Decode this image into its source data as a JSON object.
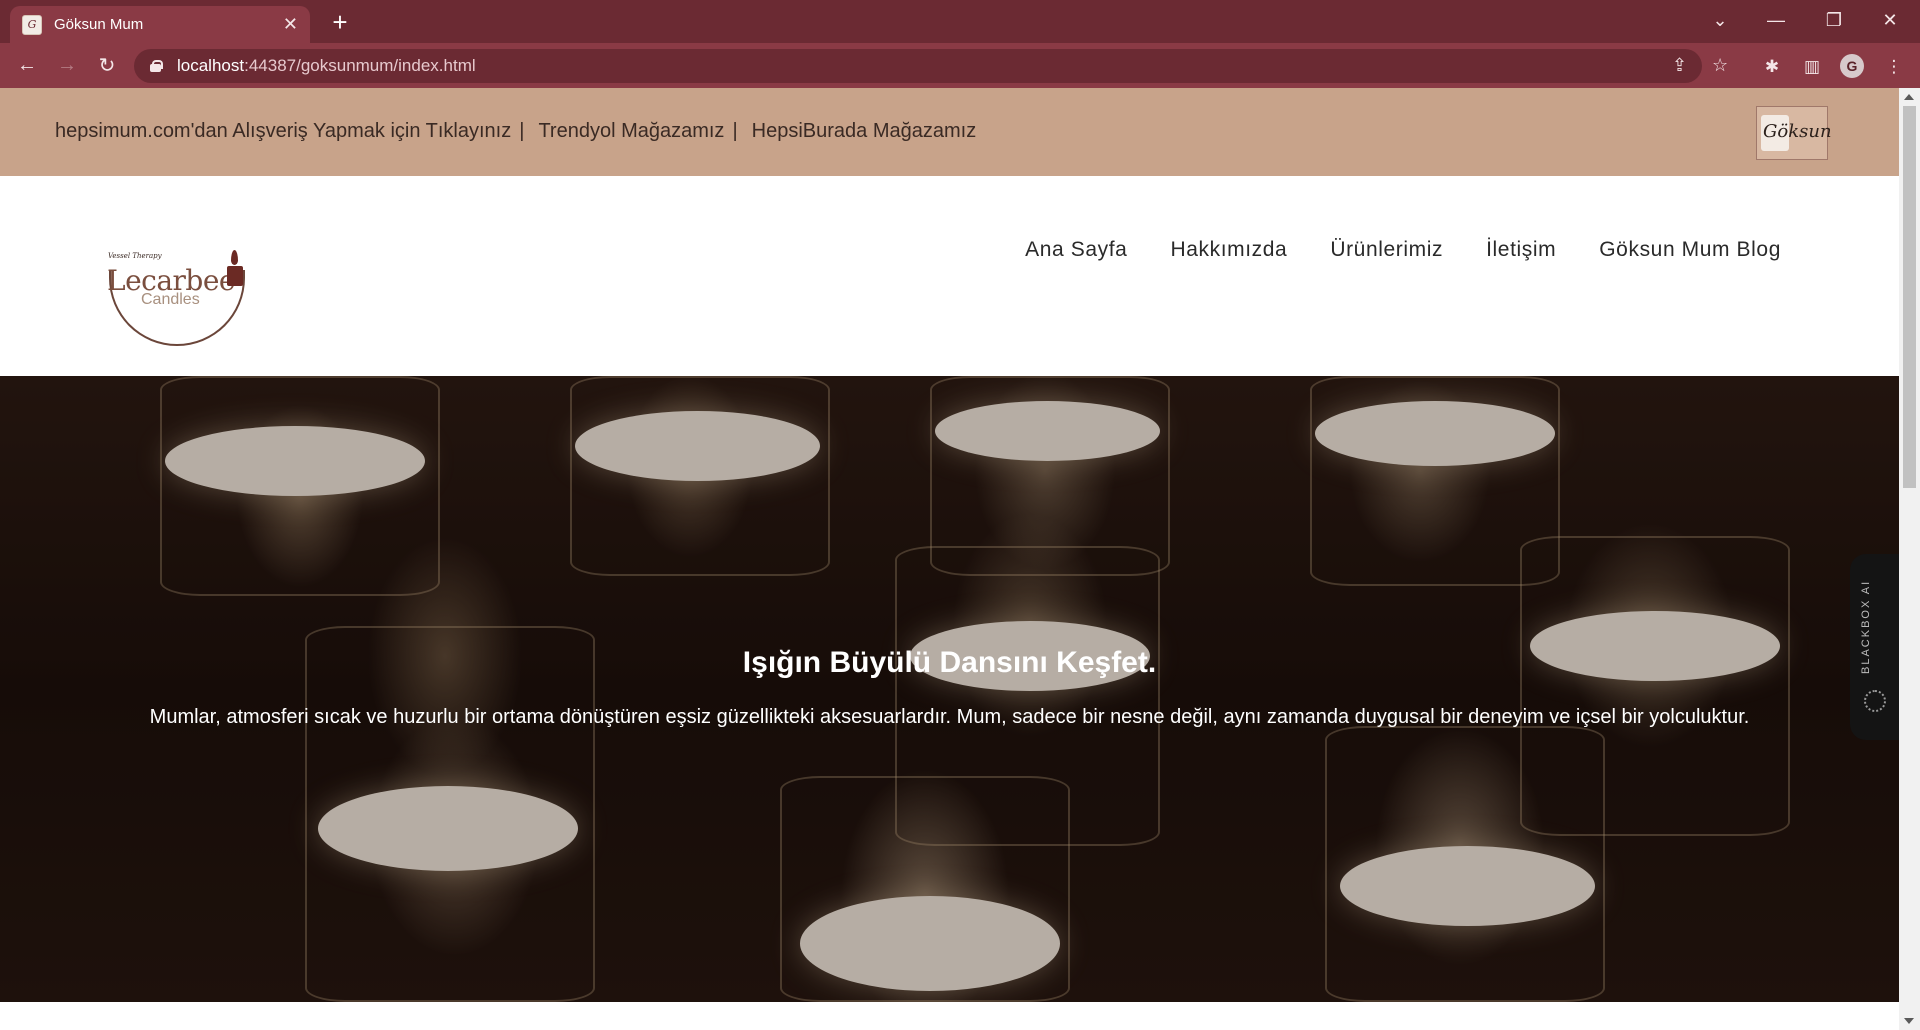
{
  "browser": {
    "tab_title": "Göksun Mum",
    "url_host": "localhost",
    "url_path": ":44387/goksunmum/index.html",
    "profile_initial": "G"
  },
  "topbar": {
    "links": [
      "hepsimum.com'dan Alışveriş Yapmak için Tıklayınız",
      "Trendyol Mağazamız",
      "HepsiBurada Mağazamız"
    ],
    "separator": "|",
    "mini_logo_text": "Göksun"
  },
  "brand": {
    "tagline": "Vessel Therapy",
    "name": "Lecarbee",
    "sub": "Candles"
  },
  "nav": {
    "items": [
      "Ana Sayfa",
      "Hakkımızda",
      "Ürünlerimiz",
      "İletişim",
      "Göksun Mum Blog"
    ]
  },
  "hero": {
    "title": "Işığın Büyülü Dansını Keşfet.",
    "text": "Mumlar, atmosferi sıcak ve huzurlu bir ortama dönüştüren eşsiz güzellikteki aksesuarlardır. Mum, sadece bir nesne değil, aynı zamanda duygusal bir deneyim ve içsel bir yolculuktur."
  },
  "widget": {
    "label": "BLACKBOX AI"
  },
  "colors": {
    "chrome_dark": "#6b2a33",
    "chrome_toolbar": "#8a3a45",
    "topbar": "#c8a38a",
    "brand_brown": "#7a4e3e"
  }
}
